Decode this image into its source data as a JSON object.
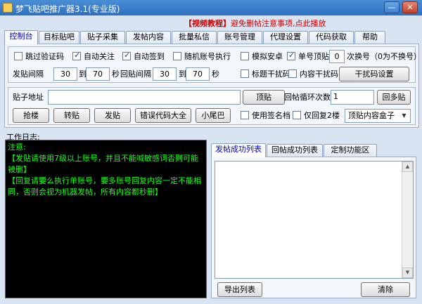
{
  "window": {
    "title": "梦飞贴吧推广器3.1(专业版)",
    "minimize_glyph": "—",
    "close_glyph": "✕"
  },
  "notice": {
    "bracket_text": "【视频教程】",
    "text": "避免删帖注意事项,点此播放"
  },
  "tabs": [
    {
      "label": "控制台"
    },
    {
      "label": "目标贴吧"
    },
    {
      "label": "贴子采集"
    },
    {
      "label": "发帖内容"
    },
    {
      "label": "批量私信"
    },
    {
      "label": "账号管理"
    },
    {
      "label": "代理设置"
    },
    {
      "label": "代码获取"
    },
    {
      "label": "帮助"
    }
  ],
  "options": {
    "skip_captcha": "跳过验证码",
    "auto_follow": "自动关注",
    "auto_sign": "自动签到",
    "random_account": "随机账号执行",
    "simulate_android": "模拟安卓",
    "single_top": "单号顶贴",
    "switch_count_value": "0",
    "switch_count_label": "次换号（0为不换号）",
    "post_interval_label": "发贴间隔",
    "post_min": "30",
    "to1": "到",
    "post_max": "70",
    "sec1": "秒",
    "reply_interval_label": "回贴间隔",
    "reply_min": "30",
    "to2": "到",
    "reply_max": "70",
    "sec2": "秒",
    "title_noise": "标题干扰码",
    "content_noise": "内容干扰码",
    "noise_settings": "干扰码设置"
  },
  "post": {
    "address_label": "贴子地址",
    "address_value": "",
    "top_button": "顶贴",
    "loop_label": "回帖循环次数",
    "loop_value": "1",
    "multi_reply_button": "回多贴",
    "grab_button": "抢楼",
    "repost_button": "转贴",
    "send_button": "发贴",
    "error_codes_button": "错误代码大全",
    "tail_button": "小尾巴",
    "use_signature": "使用签名档",
    "reply_floor2_only": "仅回复2楼",
    "content_box_select": "顶贴内容盒子"
  },
  "worklog": {
    "label": "工作日志:",
    "lines": [
      "注意:",
      "【发贴请使用7级以上账号，并且不能喊敏感词否则可能被删】",
      "【回复请要么执行单账号，要多账号回复内容一定不能相同，否则会视为机器发帖，所有内容都秒删】"
    ]
  },
  "results": {
    "tabs": [
      {
        "label": "发帖成功列表"
      },
      {
        "label": "回帖成功列表"
      },
      {
        "label": "定制功能区"
      }
    ],
    "export_button": "导出列表",
    "clear_button": "清除"
  },
  "checked": {
    "skip_captcha": false,
    "auto_follow": true,
    "auto_sign": true,
    "random_account": false,
    "simulate_android": false,
    "single_top": true,
    "title_noise": false,
    "content_noise": false,
    "use_signature": false,
    "reply_floor2_only": false
  },
  "colors": {
    "active_tab_text": "#0000c0",
    "notice_red": "#d00000",
    "log_green": "#19ff19",
    "log_background": "#000000"
  }
}
